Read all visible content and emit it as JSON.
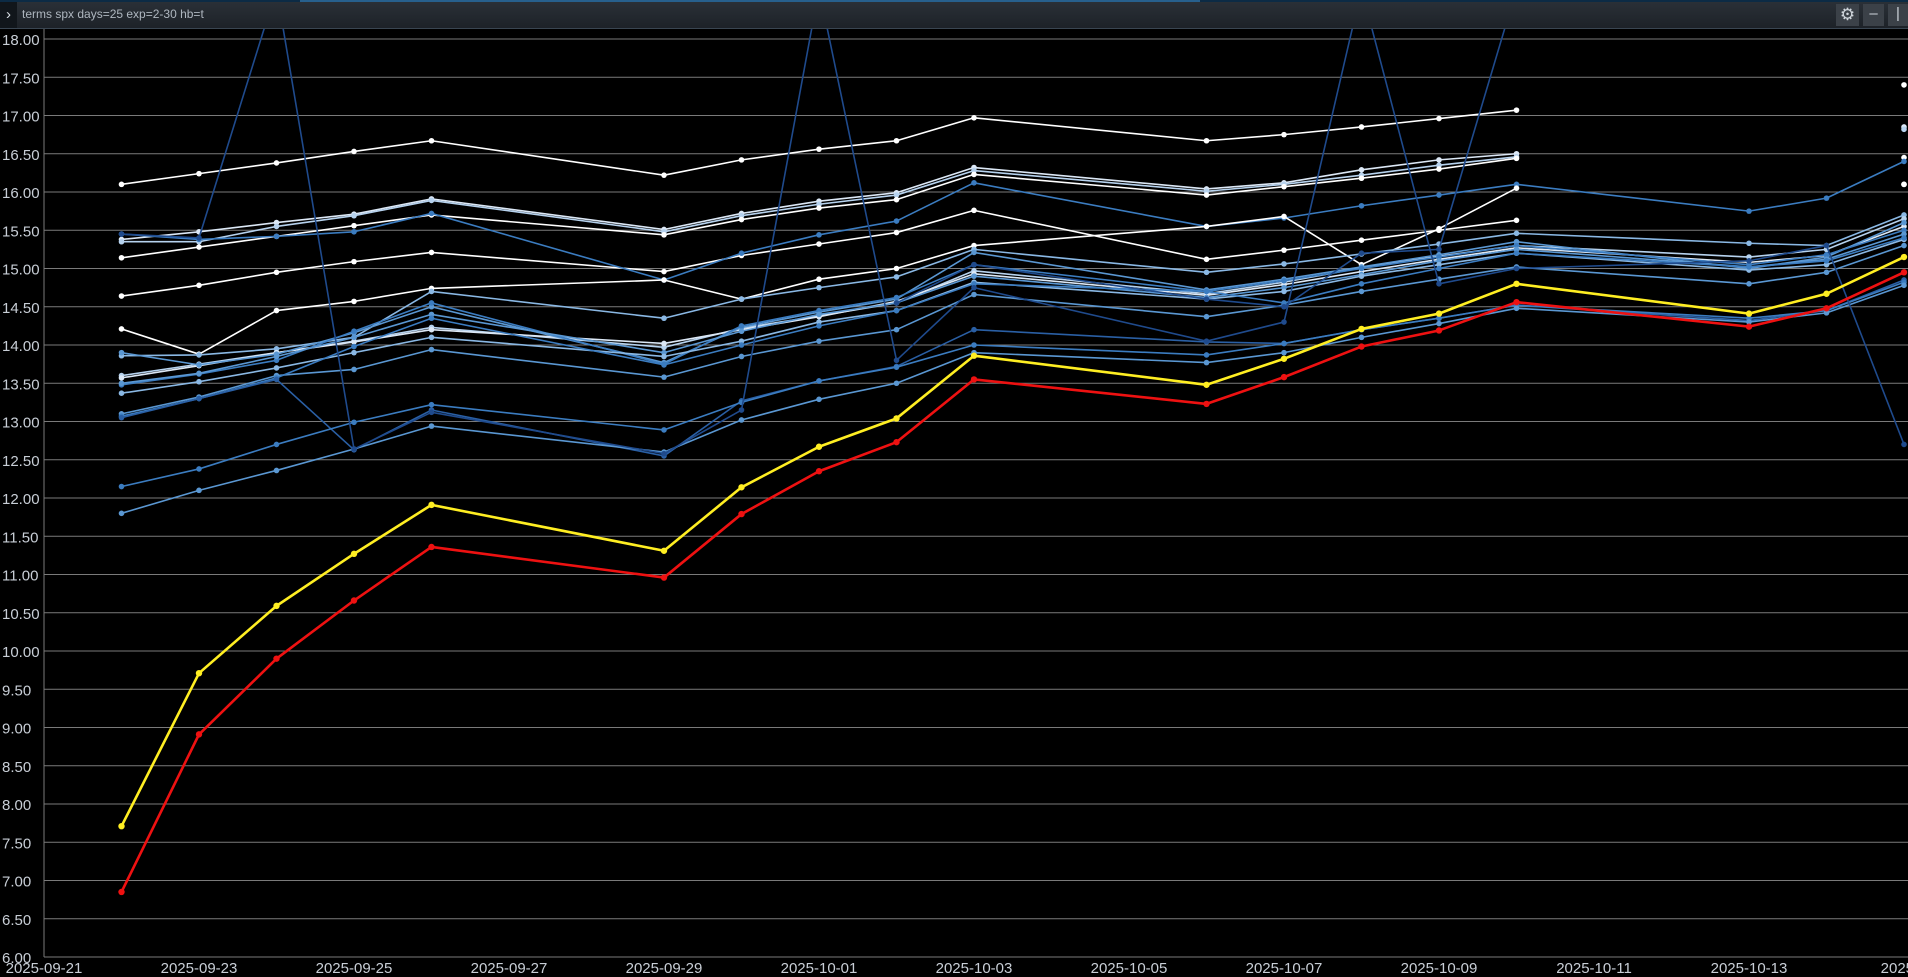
{
  "window": {
    "title": "terms spx days=25 exp=2-30 hb=t",
    "collapse_icon": "chevron-right-icon",
    "settings_icon": "gear-icon",
    "minimize_icon": "minimize-icon",
    "close_icon": "close-icon",
    "collapse_glyph": "›",
    "settings_glyph": "⚙",
    "minimize_glyph": "–",
    "close_glyph": "|"
  },
  "colors": {
    "background": "#000000",
    "gridline": "#7a7a7a",
    "highlight_yellow": "#ffee22",
    "highlight_red": "#ee1111",
    "series_palette": [
      "#ffffff",
      "#dce8f6",
      "#b6d2ee",
      "#8ab8e4",
      "#5a97d2",
      "#3b7cc0",
      "#2a5fa4",
      "#1f4a8c"
    ]
  },
  "chart_data": {
    "type": "line",
    "xlim": [
      "2025-09-21",
      "2025-10-14"
    ],
    "ylim": [
      6.0,
      18.0
    ],
    "y_ticks": [
      "18.00",
      "17.50",
      "17.00",
      "16.50",
      "16.00",
      "15.50",
      "15.00",
      "14.50",
      "14.00",
      "13.50",
      "13.00",
      "12.50",
      "12.00",
      "11.50",
      "11.00",
      "10.50",
      "10.00",
      "9.50",
      "9.00",
      "8.50",
      "8.00",
      "7.50",
      "7.00",
      "6.50",
      "6.00"
    ],
    "x_ticks": [
      "2025-09-21",
      "2025-09-23",
      "2025-09-25",
      "2025-09-27",
      "2025-09-29",
      "2025-10-01",
      "2025-10-03",
      "2025-10-05",
      "2025-10-07",
      "2025-10-09",
      "2025-10-11",
      "2025-10-13"
    ],
    "x_tick_labels": [
      "2025-09-21",
      "2025-09-23",
      "2025-09-25",
      "2025-09-27",
      "2025-09-29",
      "2025-10-01",
      "2025-10-03",
      "2025-10-05",
      "2025-10-07",
      "2025-10-09",
      "2025-10-11",
      "2025-10-13",
      "2025-1"
    ],
    "grid": "horizontal",
    "x": [
      "2025-09-22",
      "2025-09-23",
      "2025-09-24",
      "2025-09-25",
      "2025-09-26",
      "2025-09-29",
      "2025-09-30",
      "2025-10-01",
      "2025-10-02",
      "2025-10-03",
      "2025-10-06",
      "2025-10-07",
      "2025-10-08",
      "2025-10-09",
      "2025-10-10",
      "2025-10-13",
      "2025-10-14",
      "2025-10-15"
    ],
    "series": [
      {
        "color_index": 0,
        "values": [
          16.1,
          16.24,
          16.38,
          16.53,
          16.67,
          16.22,
          16.42,
          16.56,
          16.67,
          16.97,
          16.67,
          16.75,
          16.85,
          16.96,
          17.07,
          null,
          null,
          17.4
        ]
      },
      {
        "color_index": 1,
        "values": [
          15.38,
          15.48,
          15.6,
          15.71,
          15.91,
          15.51,
          15.72,
          15.88,
          15.99,
          16.32,
          16.04,
          16.12,
          16.29,
          16.42,
          16.5,
          null,
          null,
          16.85
        ]
      },
      {
        "color_index": 2,
        "values": [
          15.35,
          15.35,
          15.55,
          15.69,
          15.89,
          15.48,
          15.69,
          15.84,
          15.96,
          16.28,
          16.01,
          16.1,
          16.22,
          16.35,
          16.46,
          null,
          null,
          16.82
        ]
      },
      {
        "color_index": 0,
        "values": [
          15.14,
          15.28,
          15.42,
          15.56,
          15.7,
          15.44,
          15.64,
          15.79,
          15.9,
          16.23,
          15.96,
          16.07,
          16.18,
          16.3,
          16.44,
          null,
          null,
          16.45
        ]
      },
      {
        "color_index": 0,
        "values": [
          14.64,
          14.78,
          14.95,
          15.09,
          15.21,
          14.96,
          15.17,
          15.32,
          15.47,
          15.76,
          15.12,
          15.24,
          15.37,
          15.5,
          15.63,
          null,
          null,
          16.1
        ]
      },
      {
        "color_index": 5,
        "values": [
          15.45,
          15.38,
          15.42,
          15.48,
          15.72,
          14.85,
          15.2,
          15.44,
          15.62,
          16.12,
          15.55,
          15.66,
          15.82,
          15.96,
          16.1,
          15.75,
          15.92,
          16.4
        ]
      },
      {
        "color_index": 0,
        "values": [
          14.21,
          13.88,
          14.45,
          14.57,
          14.74,
          14.85,
          14.6,
          14.86,
          15.0,
          15.3,
          15.55,
          15.68,
          15.05,
          15.52,
          16.05,
          null,
          null,
          16.1
        ]
      },
      {
        "color_index": 3,
        "values": [
          13.86,
          13.87,
          13.95,
          14.1,
          14.7,
          14.35,
          14.6,
          14.75,
          14.89,
          15.25,
          14.95,
          15.06,
          15.19,
          15.32,
          15.46,
          15.33,
          15.3,
          15.7
        ]
      },
      {
        "color_index": 2,
        "values": [
          13.6,
          13.75,
          13.9,
          14.05,
          14.23,
          13.97,
          14.22,
          14.38,
          14.55,
          14.97,
          14.67,
          14.82,
          15.01,
          15.16,
          15.3,
          15.15,
          15.25,
          15.65
        ]
      },
      {
        "color_index": 1,
        "values": [
          13.57,
          13.73,
          13.9,
          14.04,
          14.2,
          14.02,
          14.2,
          14.37,
          14.57,
          14.93,
          14.65,
          14.79,
          14.96,
          15.12,
          15.27,
          15.08,
          15.17,
          15.55
        ]
      },
      {
        "color_index": 4,
        "values": [
          13.9,
          13.74,
          13.88,
          14.16,
          14.5,
          13.77,
          14.23,
          14.43,
          14.6,
          15.21,
          14.72,
          14.86,
          15.02,
          15.18,
          15.35,
          15.0,
          15.15,
          15.6
        ]
      },
      {
        "color_index": 5,
        "values": [
          13.48,
          13.62,
          13.8,
          14.18,
          14.55,
          13.75,
          14.25,
          14.45,
          14.62,
          15.05,
          14.7,
          14.84,
          15.0,
          15.15,
          15.3,
          15.05,
          15.18,
          15.5
        ]
      },
      {
        "color_index": 4,
        "values": [
          13.5,
          13.63,
          13.85,
          14.1,
          14.4,
          13.9,
          14.18,
          14.4,
          14.55,
          14.9,
          14.62,
          14.75,
          14.92,
          15.1,
          15.25,
          15.02,
          15.12,
          15.45
        ]
      },
      {
        "color_index": 3,
        "values": [
          13.37,
          13.52,
          13.7,
          13.9,
          14.1,
          13.85,
          14.05,
          14.3,
          14.45,
          14.82,
          14.6,
          14.7,
          14.9,
          15.05,
          15.2,
          14.98,
          15.05,
          15.38
        ]
      },
      {
        "color_index": 4,
        "values": [
          13.1,
          13.32,
          13.6,
          13.68,
          13.94,
          13.58,
          13.85,
          14.05,
          14.2,
          14.66,
          14.37,
          14.52,
          14.7,
          14.86,
          15.02,
          14.8,
          14.95,
          15.3
        ]
      },
      {
        "color_index": 5,
        "values": [
          13.07,
          13.3,
          13.57,
          13.98,
          14.35,
          13.74,
          14.0,
          14.25,
          14.45,
          14.8,
          14.7,
          14.55,
          14.8,
          15.0,
          15.2,
          15.02,
          15.1,
          15.4
        ]
      },
      {
        "color_index": 6,
        "values": [
          13.05,
          13.3,
          13.55,
          12.63,
          13.15,
          12.55,
          13.27,
          13.53,
          13.72,
          14.2,
          14.04,
          14.02,
          14.2,
          14.35,
          14.52,
          14.32,
          14.45,
          14.85
        ]
      },
      {
        "color_index": 5,
        "values": [
          12.15,
          12.38,
          12.7,
          12.99,
          13.22,
          12.89,
          13.25,
          13.53,
          13.71,
          14.0,
          13.87,
          14.02,
          14.2,
          14.35,
          14.52,
          14.35,
          14.45,
          14.82
        ]
      },
      {
        "color_index": 4,
        "values": [
          11.8,
          12.1,
          12.36,
          12.64,
          12.94,
          12.6,
          13.02,
          13.29,
          13.5,
          13.9,
          13.77,
          13.9,
          14.1,
          14.28,
          14.48,
          14.3,
          14.42,
          14.78
        ]
      },
      {
        "color_index": 7,
        "values": [
          15.45,
          15.4,
          20.0,
          12.64,
          13.12,
          12.58,
          13.15,
          20.0,
          13.8,
          14.75,
          14.05,
          14.3,
          20.0,
          14.8,
          15.0,
          15.1,
          15.3,
          12.7
        ]
      },
      {
        "color_index": 7,
        "values": [
          null,
          null,
          null,
          null,
          null,
          null,
          null,
          null,
          14.55,
          15.05,
          14.6,
          14.5,
          15.2,
          15.25,
          20.0,
          null,
          null,
          null
        ]
      },
      {
        "color_index": 8,
        "values": [
          7.71,
          9.71,
          10.59,
          11.27,
          11.91,
          11.31,
          12.14,
          12.67,
          13.04,
          13.86,
          13.48,
          13.82,
          14.21,
          14.41,
          14.8,
          14.41,
          14.67,
          15.15
        ]
      },
      {
        "color_index": 9,
        "values": [
          6.85,
          8.91,
          9.9,
          10.66,
          11.36,
          10.96,
          11.79,
          12.35,
          12.73,
          13.55,
          13.23,
          13.58,
          13.98,
          14.19,
          14.56,
          14.24,
          14.48,
          14.95
        ]
      }
    ]
  }
}
